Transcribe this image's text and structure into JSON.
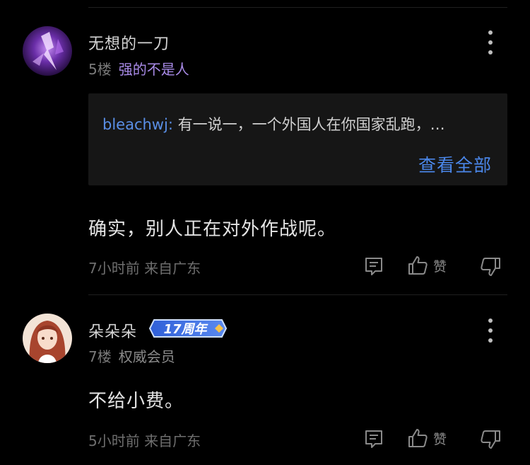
{
  "comments": [
    {
      "username": "无想的一刀",
      "floor": "5楼",
      "title": "强的不是人",
      "quote": {
        "user": "bleachwj:",
        "text": "有一说一，一个外国人在你国家乱跑，…",
        "view_all": "查看全部"
      },
      "content": "确实，别人正在对外作战呢。",
      "time_location": "7小时前 来自广东",
      "like_label": "赞"
    },
    {
      "username": "朵朵朵",
      "badge": "17周年",
      "floor": "7楼",
      "title": "权威会员",
      "content": "不给小费。",
      "time_location": "5小时前 来自广东",
      "like_label": "赞"
    }
  ],
  "icons": [
    "more-icon",
    "comment-icon",
    "thumbs-up-icon",
    "thumbs-down-icon"
  ],
  "colors": {
    "background": "#000000",
    "quote_background": "#161616",
    "link_blue": "#4a86e8",
    "title_purple": "#a98be8"
  }
}
